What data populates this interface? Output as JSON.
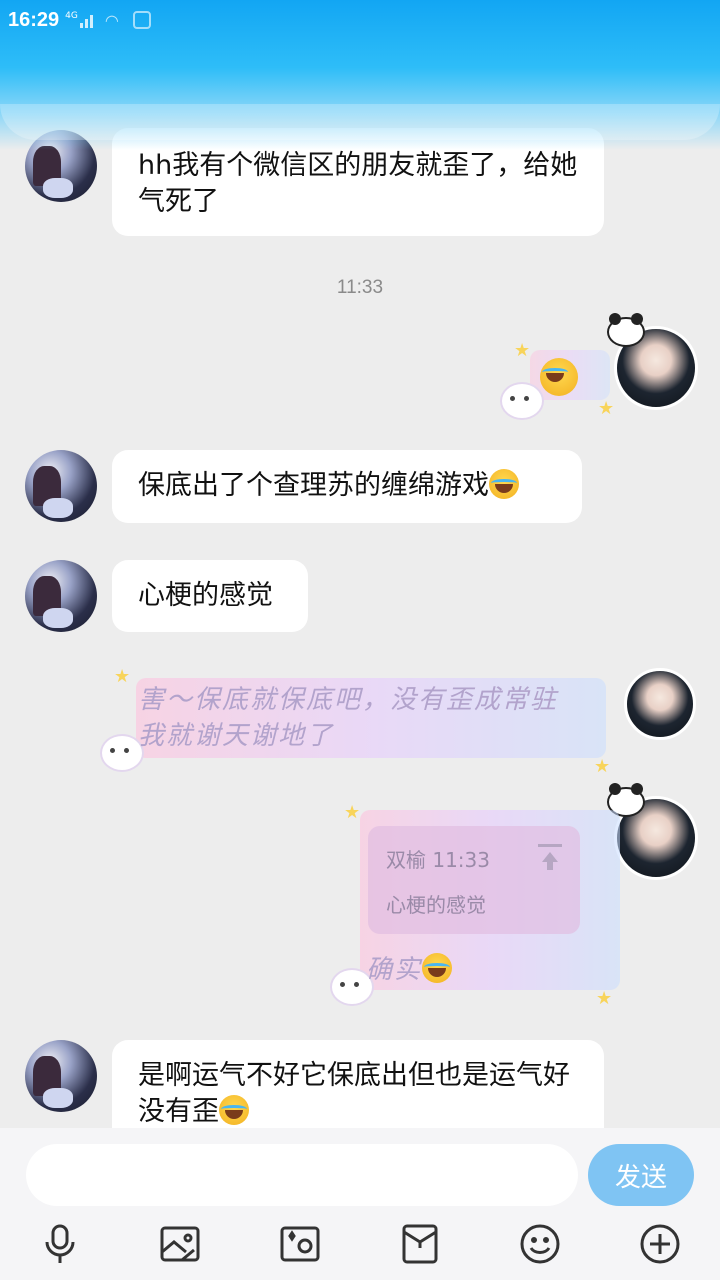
{
  "status_bar": {
    "time": "16:29",
    "network": "4G"
  },
  "messages": [
    {
      "side": "left",
      "text": "hh我有个微信区的朋友就歪了，给她气死了"
    },
    {
      "timestamp": "11:33"
    },
    {
      "side": "right",
      "type": "emoji-sticker"
    },
    {
      "side": "left",
      "text": "保底出了个查理苏的缠绵游戏"
    },
    {
      "side": "left",
      "text": "心梗的感觉"
    },
    {
      "side": "right",
      "type": "fancy",
      "text": "害～保底就保底吧，没有歪成常驻我就谢天谢地了"
    },
    {
      "side": "right",
      "type": "reply",
      "quote_author": "双榆",
      "quote_time": "11:33",
      "quote_text": "心梗的感觉",
      "text": "确实"
    },
    {
      "side": "left",
      "text": "是啊运气不好它保底出但也是运气好没有歪"
    }
  ],
  "input": {
    "placeholder": "",
    "send_label": "发送"
  },
  "toolbar": [
    "mic-icon",
    "image-icon",
    "camera-icon",
    "red-packet-icon",
    "emoji-icon",
    "plus-icon"
  ]
}
